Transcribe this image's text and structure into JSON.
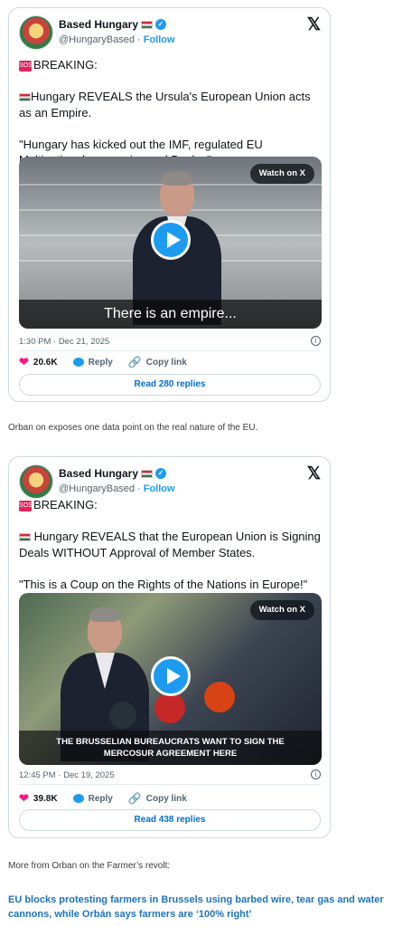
{
  "tweets": [
    {
      "name": "Based Hungary",
      "handle": "@HungaryBased",
      "sep": "·",
      "follow": "Follow",
      "x_icon": "𝕏",
      "body_line1": "BREAKING:",
      "body_rest": "Hungary REVEALS the Ursula's European Union acts as an Empire.\n\n\"Hungary has kicked out the IMF, regulated EU Multinational companies and Banks.\"",
      "watch": "Watch on X",
      "caption": "There is an empire...",
      "time": "1:30 PM · Dec 21, 2025",
      "likes": "20.6K",
      "reply": "Reply",
      "copy": "Copy link",
      "read": "Read 280 replies"
    },
    {
      "name": "Based Hungary",
      "handle": "@HungaryBased",
      "sep": "·",
      "follow": "Follow",
      "x_icon": "𝕏",
      "body_line1": "BREAKING:",
      "body_rest": "Hungary REVEALS that the European Union is Signing Deals WITHOUT Approval of Member States.\n\n\"This is a Coup on the Rights of the Nations in Europe!\"",
      "watch": "Watch on X",
      "caption": "THE BRUSSELIAN BUREAUCRATS WANT TO SIGN THE\nMERCOSUR AGREEMENT HERE",
      "time": "12:45 PM · Dec 19, 2025",
      "likes": "39.8K",
      "reply": "Reply",
      "copy": "Copy link",
      "read": "Read 438 replies"
    }
  ],
  "paragraphs": {
    "p1": "Orban on exposes one data point on the real nature of the EU.",
    "p2": "More from Orban on the Farmer’s revolt:",
    "link": "EU blocks protesting farmers in Brussels using barbed wire, tear gas and water cannons, while Orbán says farmers are ‘100% right’"
  },
  "icons": {
    "verified": "✓",
    "info": "i",
    "heart": "❤",
    "link": "🔗",
    "sos": "SOS"
  },
  "colors": {
    "accent": "#1d9bf0",
    "heart": "#f91880",
    "link": "#1e73be"
  }
}
